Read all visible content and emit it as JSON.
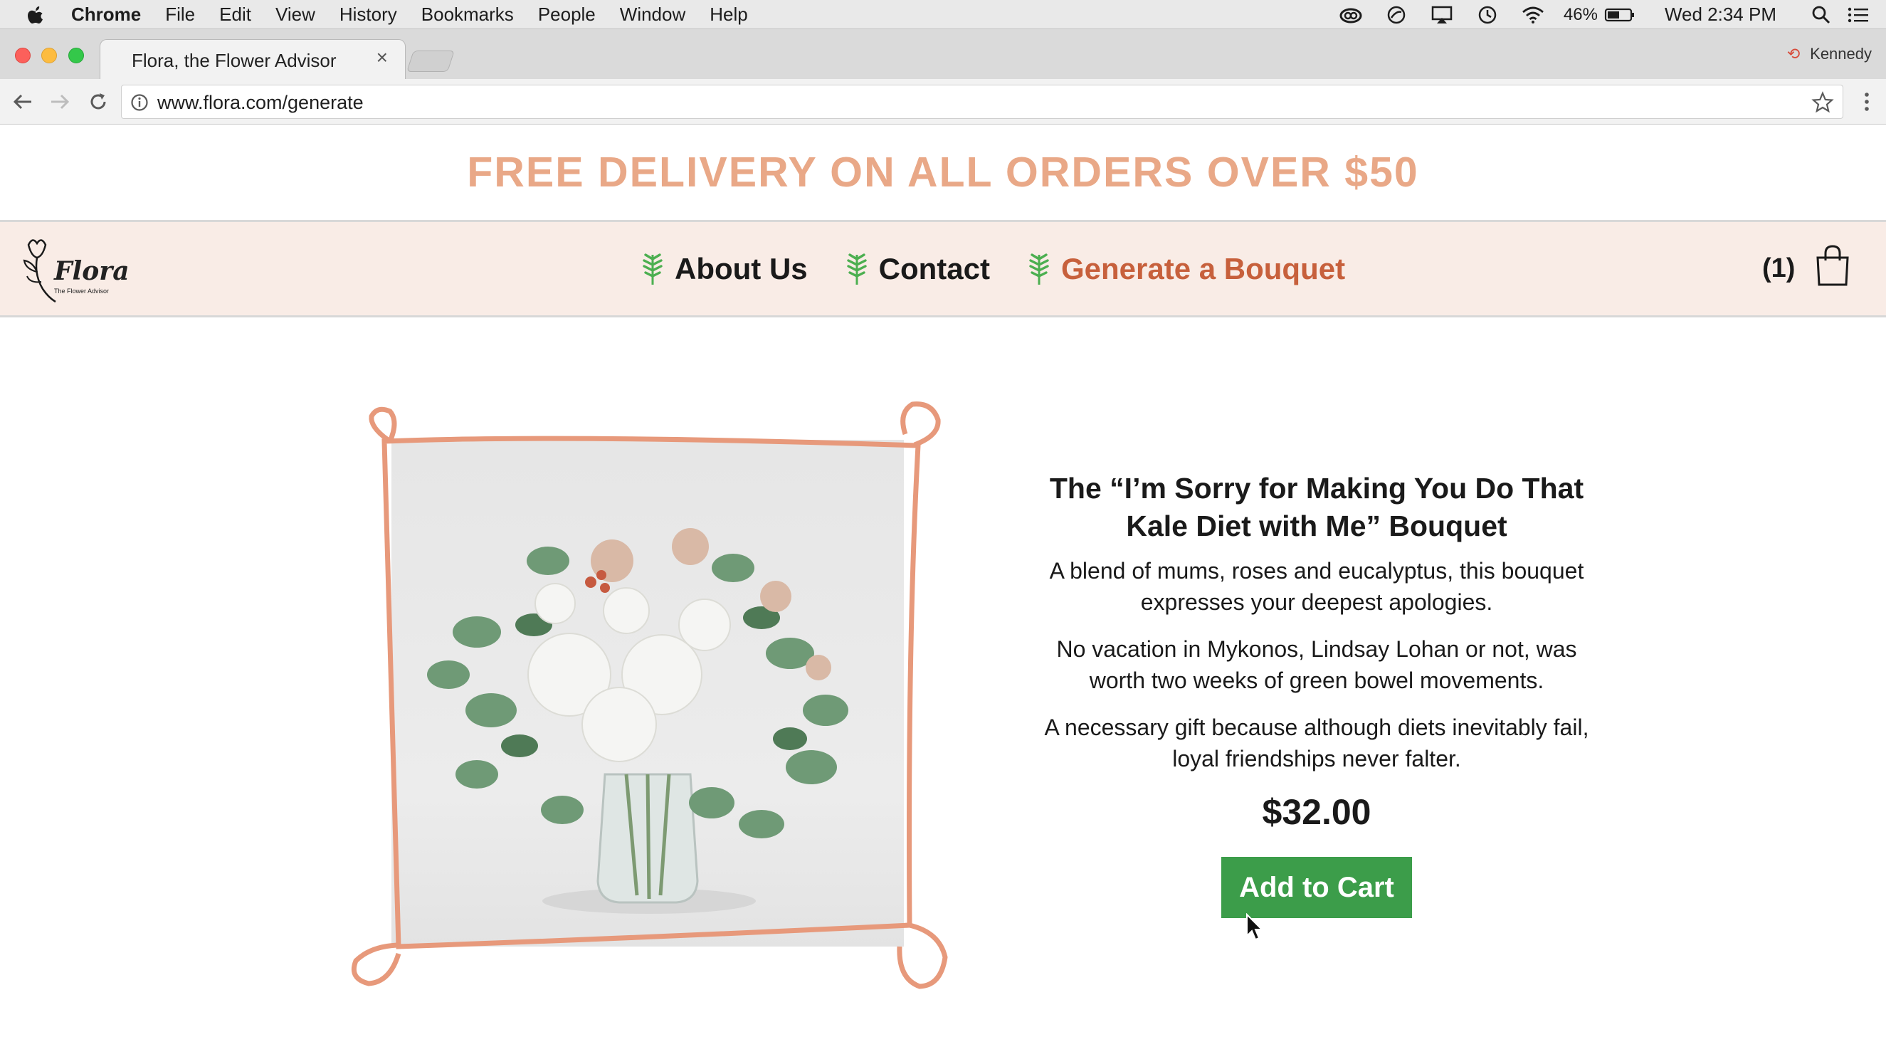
{
  "menubar": {
    "app_name": "Chrome",
    "items": [
      "File",
      "Edit",
      "View",
      "History",
      "Bookmarks",
      "People",
      "Window",
      "Help"
    ],
    "battery_percent": "46%",
    "clock": "Wed 2:34 PM"
  },
  "browser": {
    "tab_title": "Flora, the Flower Advisor",
    "tab_close": "×",
    "profile_name": "Kennedy",
    "url": "www.flora.com/generate"
  },
  "site": {
    "promo": "FREE DELIVERY ON ALL ORDERS OVER $50",
    "logo_word": "Flora",
    "logo_tagline": "The Flower Advisor",
    "nav": [
      "About Us",
      "Contact",
      "Generate a Bouquet"
    ],
    "active_nav": "Generate a Bouquet",
    "cart_count": "(1)",
    "accent_color": "#e9a887",
    "active_color": "#c7603c",
    "button_color": "#3c9d4a"
  },
  "product": {
    "title": "The “I’m  Sorry for Making You Do That Kale Diet with Me” Bouquet",
    "paragraphs": [
      "A blend of mums, roses and eucalyptus, this bouquet expresses your deepest apologies.",
      "No vacation in Mykonos, Lindsay Lohan or not, was worth two weeks of green bowel movements.",
      "A necessary gift because although diets inevitably fail, loyal friendships never falter."
    ],
    "price": "$32.00",
    "add_to_cart": "Add to Cart"
  }
}
